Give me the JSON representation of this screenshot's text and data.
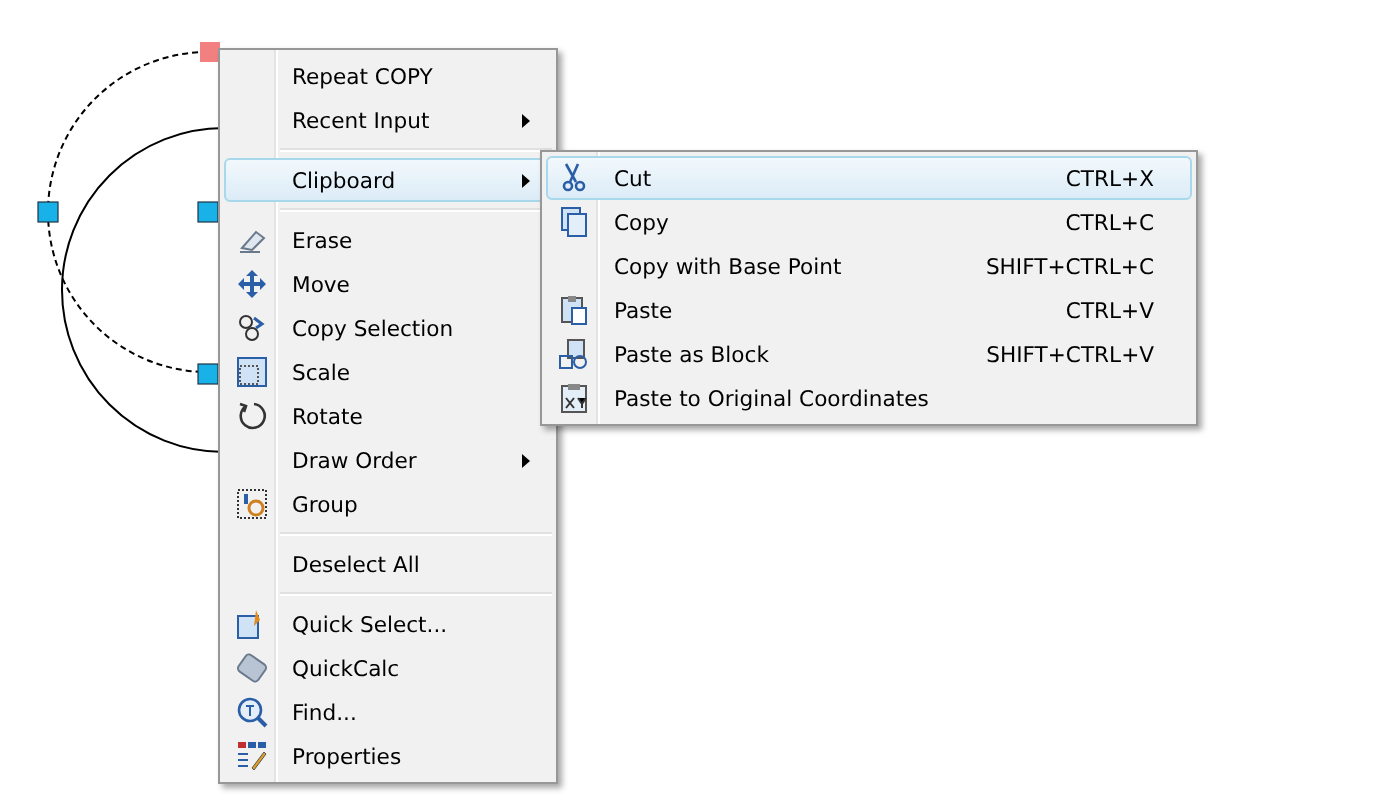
{
  "context_menu": {
    "items": [
      {
        "kind": "item",
        "label": "Repeat COPY",
        "has_submenu": false,
        "selected": false
      },
      {
        "kind": "item",
        "label": "Recent Input",
        "has_submenu": true,
        "selected": false
      },
      {
        "kind": "separator"
      },
      {
        "kind": "item",
        "label": "Clipboard",
        "has_submenu": true,
        "selected": true
      },
      {
        "kind": "separator"
      },
      {
        "kind": "item",
        "label": "Erase",
        "has_submenu": false,
        "selected": false
      },
      {
        "kind": "item",
        "label": "Move",
        "has_submenu": false,
        "selected": false
      },
      {
        "kind": "item",
        "label": "Copy Selection",
        "has_submenu": false,
        "selected": false
      },
      {
        "kind": "item",
        "label": "Scale",
        "has_submenu": false,
        "selected": false
      },
      {
        "kind": "item",
        "label": "Rotate",
        "has_submenu": false,
        "selected": false
      },
      {
        "kind": "item",
        "label": "Draw Order",
        "has_submenu": true,
        "selected": false
      },
      {
        "kind": "item",
        "label": "Group",
        "has_submenu": false,
        "selected": false
      },
      {
        "kind": "separator"
      },
      {
        "kind": "item",
        "label": "Deselect All",
        "has_submenu": false,
        "selected": false
      },
      {
        "kind": "separator"
      },
      {
        "kind": "item",
        "label": "Quick Select...",
        "has_submenu": false,
        "selected": false
      },
      {
        "kind": "item",
        "label": "QuickCalc",
        "has_submenu": false,
        "selected": false
      },
      {
        "kind": "item",
        "label": "Find...",
        "has_submenu": false,
        "selected": false
      },
      {
        "kind": "item",
        "label": "Properties",
        "has_submenu": false,
        "selected": false
      }
    ]
  },
  "clipboard_submenu": {
    "items": [
      {
        "label": "Cut",
        "shortcut": "CTRL+X",
        "selected": true
      },
      {
        "label": "Copy",
        "shortcut": "CTRL+C",
        "selected": false
      },
      {
        "label": "Copy with Base Point",
        "shortcut": "SHIFT+CTRL+C",
        "selected": false
      },
      {
        "label": "Paste",
        "shortcut": "CTRL+V",
        "selected": false
      },
      {
        "label": "Paste as Block",
        "shortcut": "SHIFT+CTRL+V",
        "selected": false
      },
      {
        "label": "Paste to Original Coordinates",
        "selected": false
      }
    ]
  }
}
